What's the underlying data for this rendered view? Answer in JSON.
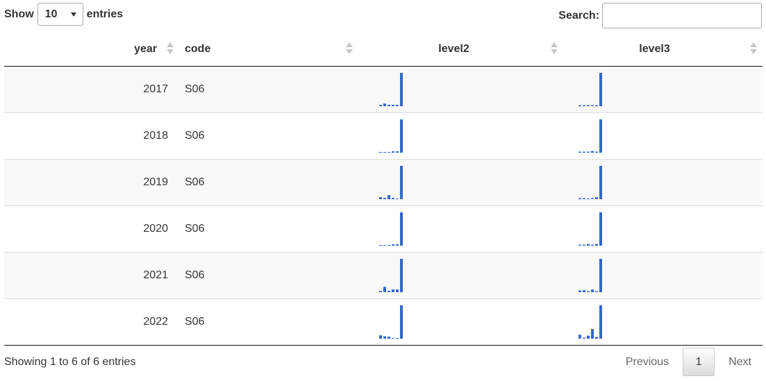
{
  "length": {
    "label_before": "Show",
    "value": "10",
    "label_after": "entries"
  },
  "search": {
    "label": "Search:",
    "value": ""
  },
  "columns": {
    "year": "year",
    "code": "code",
    "level2": "level2",
    "level3": "level3"
  },
  "colors": {
    "bar": "#3366cc"
  },
  "rows": [
    {
      "year": "2017",
      "code": "S06",
      "level2": [
        0.04,
        0.08,
        0.04,
        0.04,
        0.04,
        1.0
      ],
      "level3": [
        0.03,
        0.03,
        0.03,
        0.03,
        0.03,
        1.0
      ]
    },
    {
      "year": "2018",
      "code": "S06",
      "level2": [
        0.02,
        0.02,
        0.02,
        0.04,
        0.04,
        1.0
      ],
      "level3": [
        0.03,
        0.03,
        0.03,
        0.05,
        0.03,
        1.0
      ]
    },
    {
      "year": "2019",
      "code": "S06",
      "level2": [
        0.06,
        0.04,
        0.12,
        0.04,
        0.02,
        1.0
      ],
      "level3": [
        0.03,
        0.03,
        0.01,
        0.03,
        0.06,
        1.0
      ]
    },
    {
      "year": "2020",
      "code": "S06",
      "level2": [
        0.02,
        0.02,
        0.02,
        0.04,
        0.04,
        1.0
      ],
      "level3": [
        0.03,
        0.03,
        0.05,
        0.03,
        0.05,
        1.0
      ]
    },
    {
      "year": "2021",
      "code": "S06",
      "level2": [
        0.04,
        0.16,
        0.04,
        0.08,
        0.08,
        1.0
      ],
      "level3": [
        0.05,
        0.06,
        0.03,
        0.08,
        0.03,
        1.0
      ]
    },
    {
      "year": "2022",
      "code": "S06",
      "level2": [
        0.1,
        0.07,
        0.06,
        0.02,
        0.02,
        1.0
      ],
      "level3": [
        0.12,
        0.03,
        0.09,
        0.29,
        0.05,
        1.0
      ]
    }
  ],
  "info": "Showing 1 to 6 of 6 entries",
  "pagination": {
    "previous": "Previous",
    "current": "1",
    "next": "Next"
  }
}
